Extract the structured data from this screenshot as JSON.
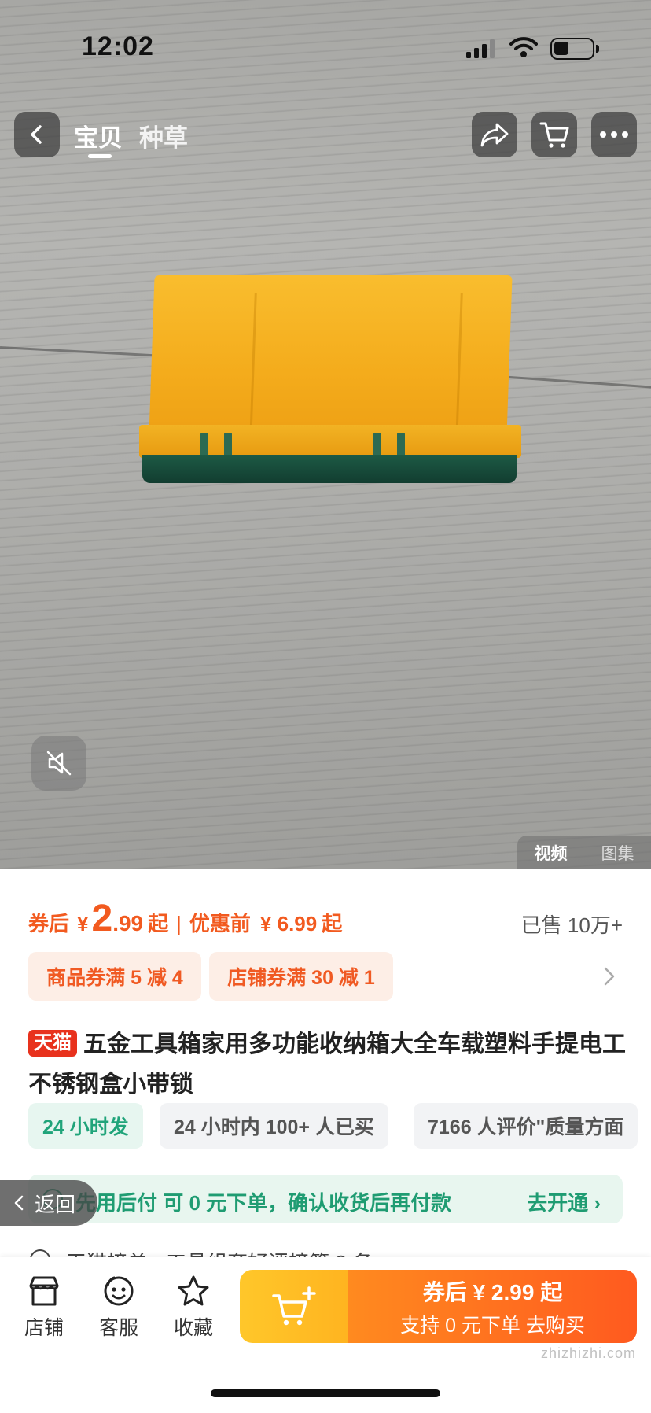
{
  "status_bar": {
    "time": "12:02"
  },
  "nav": {
    "tab_active": "宝贝",
    "tab_2": "种草"
  },
  "hero": {
    "tab_video": "视频",
    "tab_images": "图集"
  },
  "price": {
    "after_coupon_label": "券后",
    "currency": "¥",
    "price_int": "2",
    "price_dec": ".99",
    "price_suffix": "起",
    "separator": "|",
    "before_label": "优惠前",
    "before_price": "¥ 6.99",
    "before_suffix": "起",
    "sold": "已售 10万+"
  },
  "coupons": [
    {
      "label": "商品券满 5 减 4"
    },
    {
      "label": "店铺券满 30 减 1"
    }
  ],
  "product": {
    "badge": "天猫",
    "title": "五金工具箱家用多功能收纳箱大全车载塑料手提电工不锈钢盒小带锁"
  },
  "tags": [
    {
      "label": "24 小时发"
    },
    {
      "label": "24 小时内 100+ 人已买"
    },
    {
      "label": "7166 人评价\"质量方面"
    }
  ],
  "pay_later": {
    "text": "先用后付 可 0 元下单，确认收货后再付款",
    "action": "去开通 ›"
  },
  "back_float": {
    "label": "返回"
  },
  "peek_row": {
    "text": "天猫榜单 · 工具组套好评榜第 2 名"
  },
  "bottom_bar": {
    "store": "店铺",
    "service": "客服",
    "favorite": "收藏",
    "buy_line1": "券后 ¥ 2.99 起",
    "buy_line2": "支持 0 元下单  去购买"
  },
  "watermark": "zhizhizhi.com",
  "colors": {
    "accent": "#f25a1f",
    "green": "#1f9c72",
    "cta_yellow": "#ffc72a",
    "cta_orange": "#ff5a1f"
  }
}
